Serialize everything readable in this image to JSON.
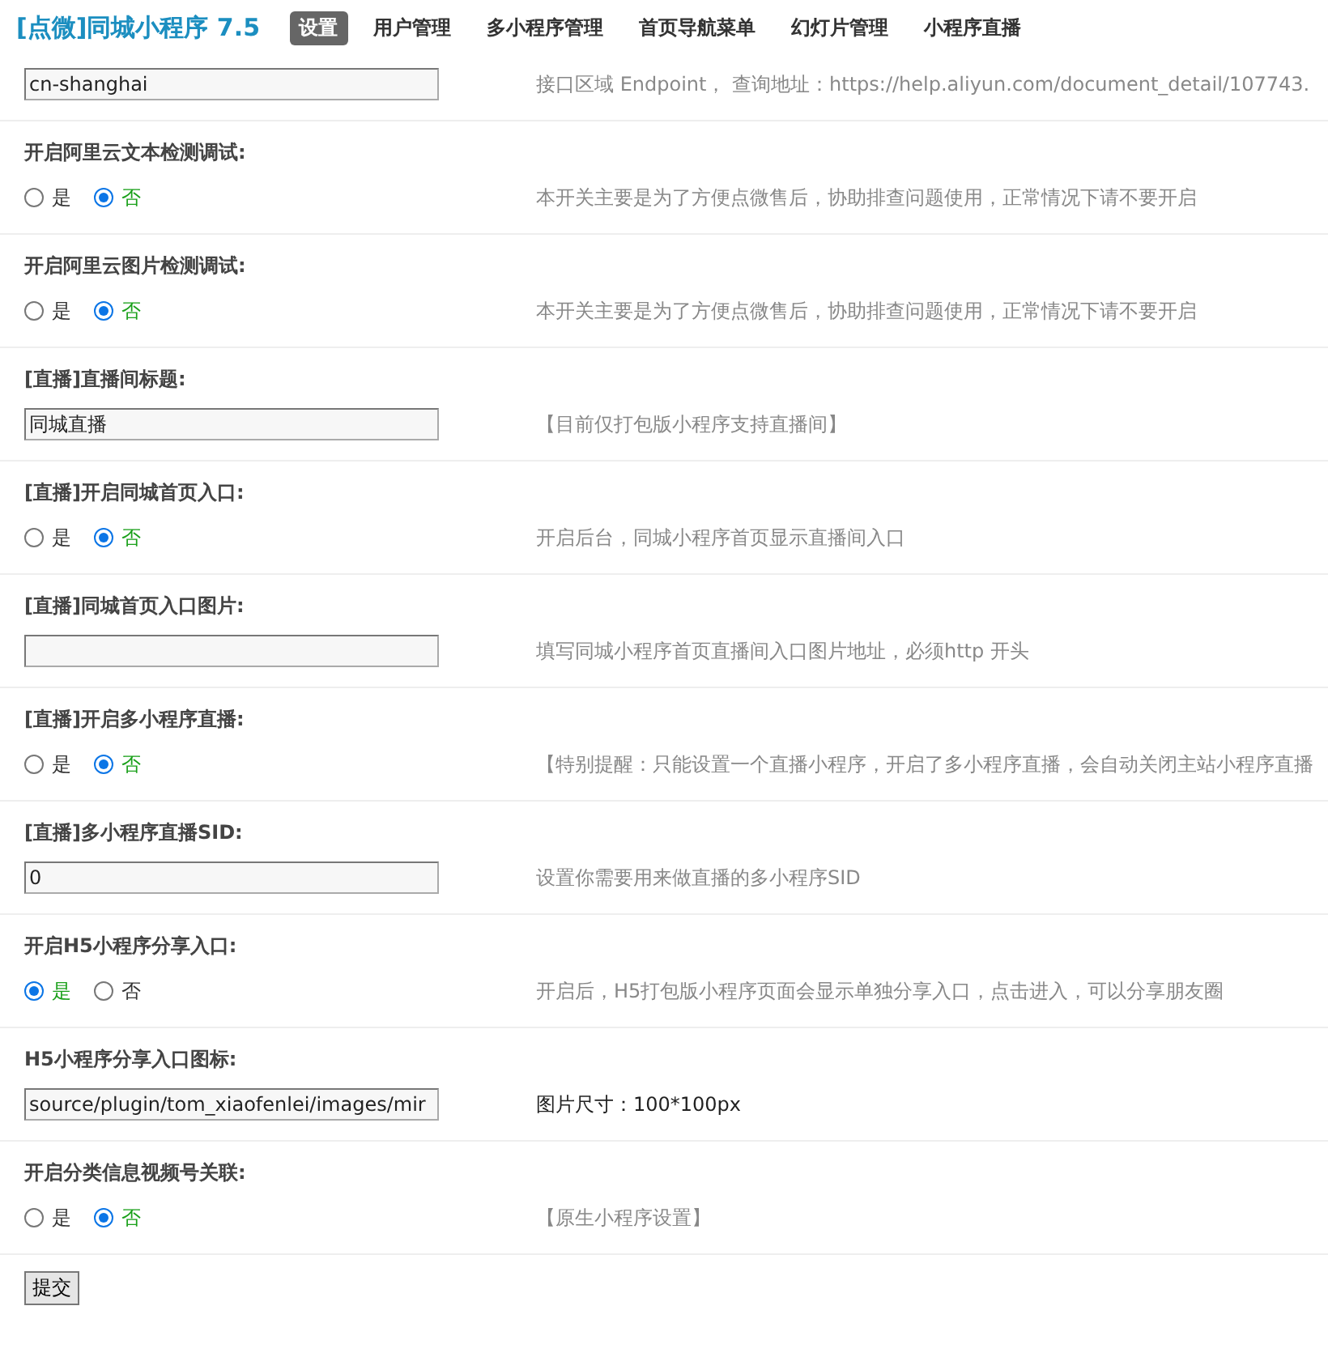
{
  "header": {
    "title": "[点微]同城小程序 7.5",
    "tabs": [
      {
        "label": "设置",
        "selected": true
      },
      {
        "label": "用户管理",
        "selected": false
      },
      {
        "label": "多小程序管理",
        "selected": false
      },
      {
        "label": "首页导航菜单",
        "selected": false
      },
      {
        "label": "幻灯片管理",
        "selected": false
      },
      {
        "label": "小程序直播",
        "selected": false
      }
    ]
  },
  "rows": [
    {
      "kind": "input",
      "value": "cn-shanghai",
      "hint": "接口区域 Endpoint， 查询地址：https://help.aliyun.com/document_detail/107743.",
      "hint_muted": true
    },
    {
      "kind": "radio",
      "label": "开启阿里云文本检测调试:",
      "options": [
        {
          "label": "是",
          "selected": false
        },
        {
          "label": "否",
          "selected": true
        }
      ],
      "hint": "本开关主要是为了方便点微售后，协助排查问题使用，正常情况下请不要开启",
      "hint_muted": true
    },
    {
      "kind": "radio",
      "label": "开启阿里云图片检测调试:",
      "options": [
        {
          "label": "是",
          "selected": false
        },
        {
          "label": "否",
          "selected": true
        }
      ],
      "hint": "本开关主要是为了方便点微售后，协助排查问题使用，正常情况下请不要开启",
      "hint_muted": true
    },
    {
      "kind": "input",
      "label": "[直播]直播间标题:",
      "value": "同城直播",
      "hint": "【目前仅打包版小程序支持直播间】",
      "hint_muted": true
    },
    {
      "kind": "radio",
      "label": "[直播]开启同城首页入口:",
      "options": [
        {
          "label": "是",
          "selected": false
        },
        {
          "label": "否",
          "selected": true
        }
      ],
      "hint": "开启后台，同城小程序首页显示直播间入口",
      "hint_muted": true
    },
    {
      "kind": "input",
      "label": "[直播]同城首页入口图片:",
      "hint": "填写同城小程序首页直播间入口图片地址，必须http 开头",
      "hint_muted": true
    },
    {
      "kind": "radio",
      "label": "[直播]开启多小程序直播:",
      "options": [
        {
          "label": "是",
          "selected": false
        },
        {
          "label": "否",
          "selected": true
        }
      ],
      "hint": "【特别提醒：只能设置一个直播小程序，开启了多小程序直播，会自动关闭主站小程序直播",
      "hint_muted": true
    },
    {
      "kind": "input",
      "label": "[直播]多小程序直播SID:",
      "value": "0",
      "hint": "设置你需要用来做直播的多小程序SID",
      "hint_muted": true
    },
    {
      "kind": "radio",
      "label": "开启H5小程序分享入口:",
      "options": [
        {
          "label": "是",
          "selected": true
        },
        {
          "label": "否",
          "selected": false
        }
      ],
      "hint": "开启后，H5打包版小程序页面会显示单独分享入口，点击进入，可以分享朋友圈",
      "hint_muted": true
    },
    {
      "kind": "input",
      "label": "H5小程序分享入口图标:",
      "value": "source/plugin/tom_xiaofenlei/images/mir",
      "hint": "图片尺寸：100*100px",
      "hint_muted": false
    },
    {
      "kind": "radio",
      "label": "开启分类信息视频号关联:",
      "options": [
        {
          "label": "是",
          "selected": false
        },
        {
          "label": "否",
          "selected": true
        }
      ],
      "hint": "【原生小程序设置】",
      "hint_muted": true
    }
  ],
  "submit": "提交"
}
